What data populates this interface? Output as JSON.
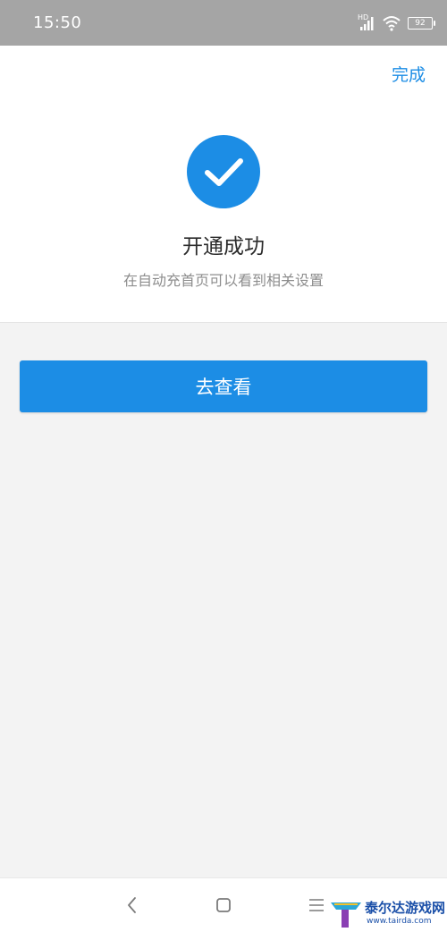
{
  "status_bar": {
    "time": "15:50",
    "network_label": "HD",
    "battery_level": "92"
  },
  "header": {
    "done_label": "完成"
  },
  "result": {
    "icon": "check-icon",
    "title": "开通成功",
    "subtitle": "在自动充首页可以看到相关设置"
  },
  "actions": {
    "view_label": "去查看"
  },
  "nav_bar": {
    "back_icon": "back-icon",
    "home_icon": "home-icon",
    "menu_icon": "menu-icon"
  },
  "watermark": {
    "brand": "泰尔达游戏网",
    "url": "www.tairda.com"
  },
  "colors": {
    "accent": "#1c8de5",
    "page_background": "#f3f3f3",
    "status_bar": "#a5a5a5"
  }
}
